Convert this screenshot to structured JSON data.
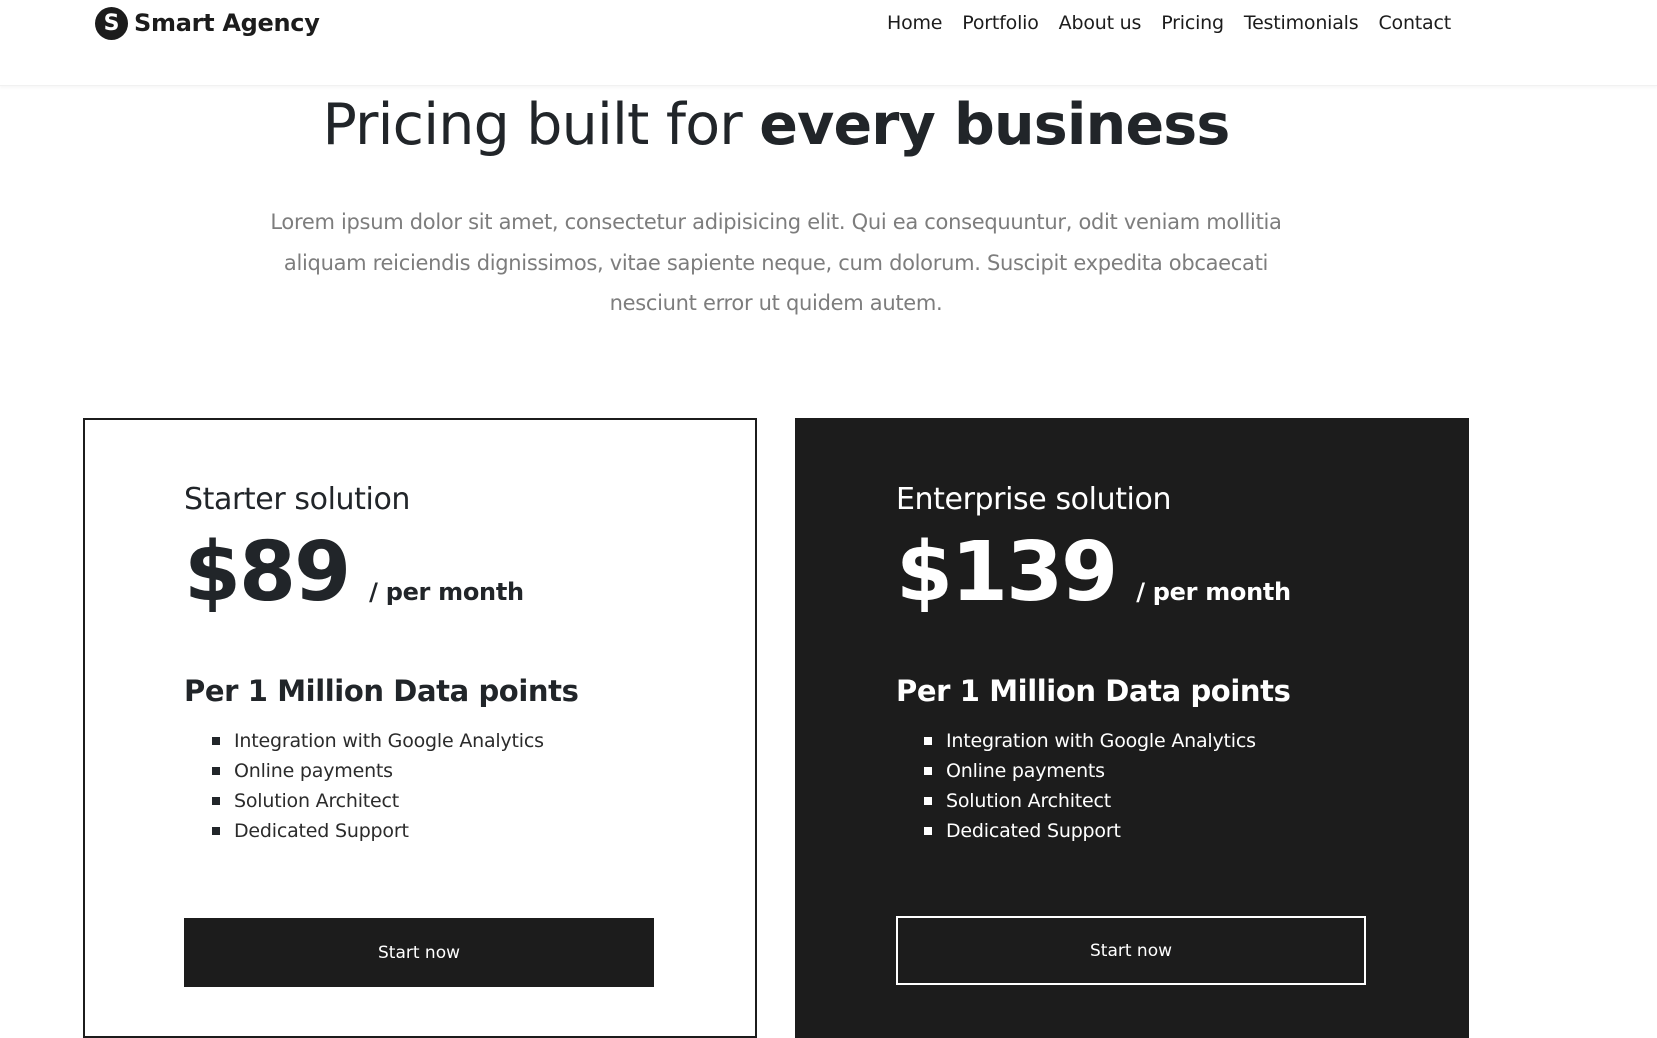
{
  "brand": {
    "logo_letter": "S",
    "name": "Smart Agency"
  },
  "nav": {
    "items": [
      {
        "label": "Home"
      },
      {
        "label": "Portfolio"
      },
      {
        "label": "About us"
      },
      {
        "label": "Pricing"
      },
      {
        "label": "Testimonials"
      },
      {
        "label": "Contact"
      }
    ]
  },
  "hero": {
    "title_regular": "Pricing built for ",
    "title_bold": "every business",
    "description": "Lorem ipsum dolor sit amet, consectetur adipisicing elit. Qui ea consequuntur, odit veniam mollitia aliquam reiciendis dignissimos, vitae sapiente neque, cum dolorum. Suscipit expedita obcaecati nesciunt error ut quidem autem."
  },
  "plans": [
    {
      "name": "Starter solution",
      "price": "$89",
      "period": "/ per month",
      "data_points": "Per 1 Million Data points",
      "features": [
        "Integration with Google Analytics",
        "Online payments",
        "Solution Architect",
        "Dedicated Support"
      ],
      "button_label": "Start now"
    },
    {
      "name": "Enterprise solution",
      "price": "$139",
      "period": "/ per month",
      "data_points": "Per 1 Million Data points",
      "features": [
        "Integration with Google Analytics",
        "Online payments",
        "Solution Architect",
        "Dedicated Support"
      ],
      "button_label": "Start now"
    }
  ],
  "colors": {
    "dark": "#1c1c1c",
    "muted_text": "#7d7d7d",
    "white": "#ffffff"
  }
}
